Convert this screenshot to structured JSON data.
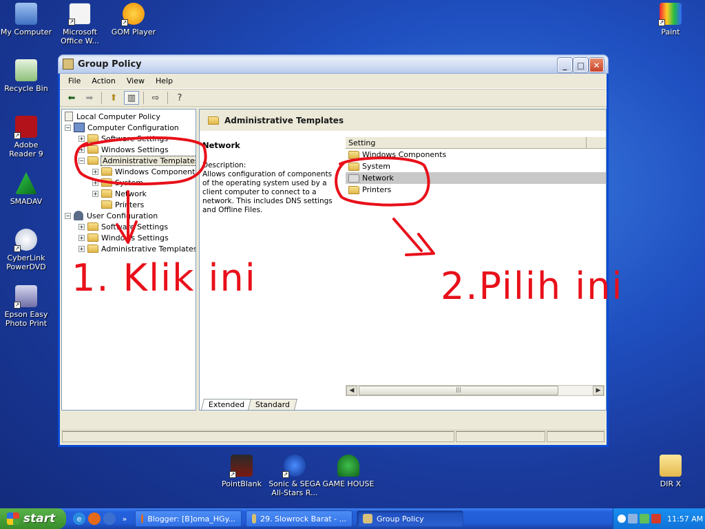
{
  "desktop": {
    "icons_left": [
      {
        "label": "My Computer",
        "icon": "computer-icon"
      },
      {
        "label": "Microsoft Office W...",
        "icon": "word-icon"
      },
      {
        "label": "GOM Player",
        "icon": "gom-player-icon"
      },
      {
        "label": "Recycle Bin",
        "icon": "recycle-bin-icon"
      },
      {
        "label": "Adobe Reader 9",
        "icon": "adobe-reader-icon"
      },
      {
        "label": "SMADAV",
        "icon": "smadav-icon"
      },
      {
        "label": "CyberLink PowerDVD",
        "icon": "powerdvd-icon"
      },
      {
        "label": "Epson Easy Photo Print",
        "icon": "epson-icon"
      }
    ],
    "icons_right": [
      {
        "label": "Paint",
        "icon": "paint-icon"
      },
      {
        "label": "DIR X",
        "icon": "folder-icon"
      }
    ],
    "icons_bottom": [
      {
        "label": "PointBlank",
        "icon": "pointblank-icon"
      },
      {
        "label": "Sonic & SEGA All-Stars R...",
        "icon": "sonic-icon"
      },
      {
        "label": "GAME HOUSE",
        "icon": "gamehouse-icon"
      }
    ]
  },
  "window": {
    "title": "Group Policy",
    "menu": [
      "File",
      "Action",
      "View",
      "Help"
    ],
    "tree": {
      "root": "Local Computer Policy",
      "computer_config": "Computer Configuration",
      "software_settings": "Software Settings",
      "windows_settings": "Windows Settings",
      "admin_templates": "Administrative Templates",
      "windows_components": "Windows Components",
      "system": "System",
      "network": "Network",
      "printers": "Printers",
      "user_config": "User Configuration",
      "u_software_settings": "Software Settings",
      "u_windows_settings": "Windows Settings",
      "u_admin_templates": "Administrative Templates"
    },
    "detail": {
      "header": "Administrative Templates",
      "selected_title": "Network",
      "description_label": "Description:",
      "description": "Allows configuration of components of the operating system used by a client computer to connect to a network. This includes DNS settings and Offline Files.",
      "column_setting": "Setting",
      "rows": [
        "Windows Components",
        "System",
        "Network",
        "Printers"
      ]
    },
    "tabs": [
      "Extended",
      "Standard"
    ]
  },
  "annotations": {
    "step1": "1. Klik ini",
    "step2": "2.Pilih ini"
  },
  "taskbar": {
    "start": "start",
    "tasks": [
      "Blogger: [B]oma_HGy...",
      "29. Slowrock Barat - ...",
      "Group Policy"
    ],
    "clock": "11:57 AM"
  }
}
